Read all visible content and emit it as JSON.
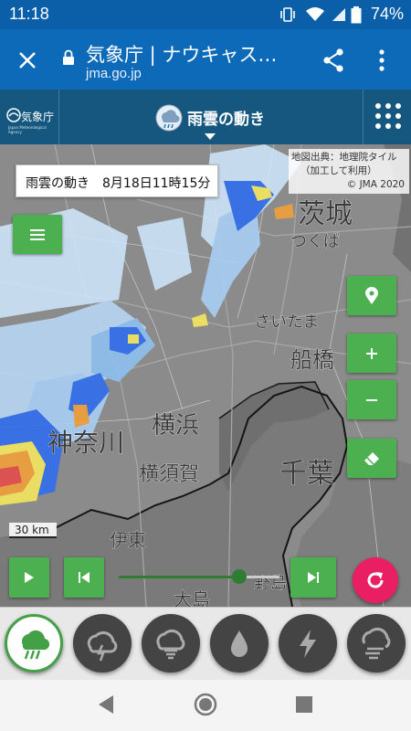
{
  "status_bar": {
    "time": "11:18",
    "battery": "74%",
    "icons": [
      "vibrate-icon",
      "wifi-icon",
      "signal-icon",
      "battery-icon"
    ]
  },
  "browser": {
    "title": "気象庁 | ナウキャス…",
    "url": "jma.go.jp",
    "icons": [
      "close-icon",
      "lock-icon",
      "share-icon",
      "more-vert-icon"
    ]
  },
  "site_header": {
    "logo_text": "気象庁",
    "logo_sub": "Japan Meteorological Agency",
    "page_title": "雨雲の動き",
    "icons": [
      "jma-logo-icon",
      "rain-cloud-icon",
      "caret-down-icon",
      "app-grid-icon"
    ]
  },
  "map": {
    "timestamp": "雨雲の動き　8月18日11時15分",
    "credit_line1": "地図出典：地理院タイル",
    "credit_line2": "（加工して利用）",
    "credit_line3": "© JMA 2020",
    "scale": "30 km",
    "place_labels": [
      "茨城",
      "つくば",
      "さいたま",
      "船橋",
      "千葉",
      "横浜",
      "横須賀",
      "伊東",
      "大島",
      "野島",
      "神奈川"
    ],
    "slider_position": 0.74,
    "buttons": [
      "menu-icon",
      "location-icon",
      "zoom-in-icon",
      "zoom-out-icon",
      "eraser-icon",
      "play-icon",
      "skip-back-icon",
      "skip-forward-icon",
      "refresh-icon"
    ],
    "colors": {
      "button_green": "#4caf50",
      "refresh_pink": "#e91e63",
      "header_blue": "#15577f",
      "bar_blue": "#0d6ab9"
    }
  },
  "categories": [
    {
      "name": "rain",
      "icon": "rain-icon",
      "active": true
    },
    {
      "name": "thunder-cloud",
      "icon": "thunder-cloud-icon",
      "active": false
    },
    {
      "name": "tornado",
      "icon": "tornado-icon",
      "active": false
    },
    {
      "name": "drop",
      "icon": "drop-icon",
      "active": false
    },
    {
      "name": "lightning",
      "icon": "lightning-icon",
      "active": false
    },
    {
      "name": "wind",
      "icon": "wind-icon",
      "active": false
    }
  ]
}
